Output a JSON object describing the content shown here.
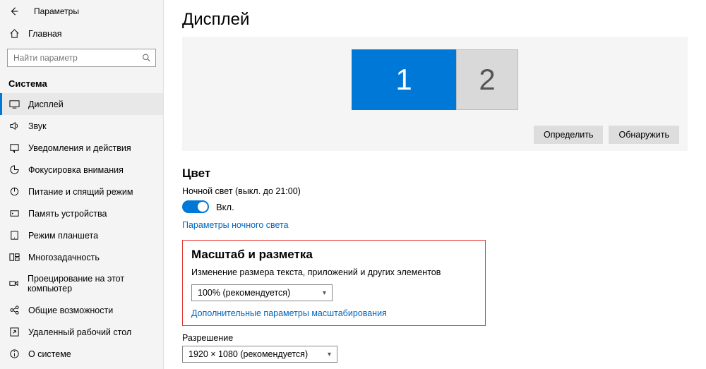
{
  "header": {
    "app_title": "Параметры"
  },
  "sidebar": {
    "home_label": "Главная",
    "search_placeholder": "Найти параметр",
    "section_label": "Система",
    "items": [
      {
        "label": "Дисплей"
      },
      {
        "label": "Звук"
      },
      {
        "label": "Уведомления и действия"
      },
      {
        "label": "Фокусировка внимания"
      },
      {
        "label": "Питание и спящий режим"
      },
      {
        "label": "Память устройства"
      },
      {
        "label": "Режим планшета"
      },
      {
        "label": "Многозадачность"
      },
      {
        "label": "Проецирование на этот компьютер"
      },
      {
        "label": "Общие возможности"
      },
      {
        "label": "Удаленный рабочий стол"
      },
      {
        "label": "О системе"
      }
    ]
  },
  "main": {
    "title": "Дисплей",
    "monitors": {
      "m1": "1",
      "m2": "2"
    },
    "buttons": {
      "identify": "Определить",
      "detect": "Обнаружить"
    },
    "color": {
      "heading": "Цвет",
      "nightlight_status": "Ночной свет (выкл. до 21:00)",
      "toggle_label": "Вкл.",
      "link": "Параметры ночного света"
    },
    "scale": {
      "heading": "Масштаб и разметка",
      "desc": "Изменение размера текста, приложений и других элементов",
      "select_value": "100% (рекомендуется)",
      "link": "Дополнительные параметры масштабирования"
    },
    "resolution": {
      "label": "Разрешение",
      "select_value": "1920 × 1080 (рекомендуется)"
    }
  }
}
